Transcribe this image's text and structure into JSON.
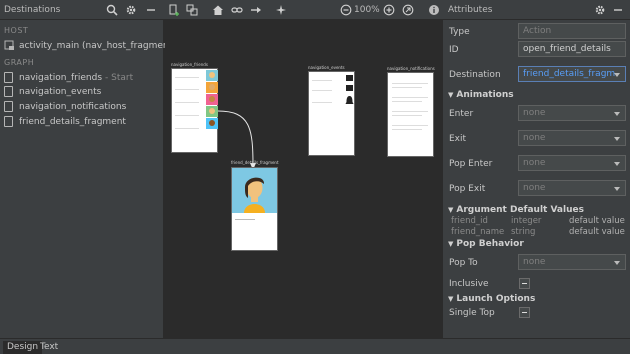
{
  "toolbar": {
    "destinations_title": "Destinations",
    "zoom": "100%",
    "attributes_title": "Attributes"
  },
  "left": {
    "host_header": "HOST",
    "host_item": "activity_main (nav_host_fragment)",
    "graph_header": "GRAPH",
    "items": [
      {
        "label": "navigation_friends",
        "sub": "- Start"
      },
      {
        "label": "navigation_events",
        "sub": ""
      },
      {
        "label": "navigation_notifications",
        "sub": ""
      },
      {
        "label": "friend_details_fragment",
        "sub": ""
      }
    ]
  },
  "canvas": {
    "screens": [
      {
        "label": "navigation_friends"
      },
      {
        "label": "navigation_events"
      },
      {
        "label": "navigation_notifications"
      },
      {
        "label": "friend_details_fragment"
      }
    ]
  },
  "attributes": {
    "type_label": "Type",
    "type_value": "Action",
    "id_label": "ID",
    "id_value": "open_friend_details",
    "destination_label": "Destination",
    "destination_value": "friend_details_fragm",
    "animations_header": "Animations",
    "enter_label": "Enter",
    "exit_label": "Exit",
    "pop_enter_label": "Pop Enter",
    "pop_exit_label": "Pop Exit",
    "none": "none",
    "arg_header": "Argument Default Values",
    "args": [
      {
        "name": "friend_id",
        "type": "integer",
        "default": "default value"
      },
      {
        "name": "friend_name",
        "type": "string",
        "default": "default value"
      }
    ],
    "pop_behavior_header": "Pop Behavior",
    "pop_to_label": "Pop To",
    "inclusive_label": "Inclusive",
    "launch_header": "Launch Options",
    "single_top_label": "Single Top"
  },
  "bottom_tabs": {
    "design": "Design",
    "text": "Text"
  },
  "colors": {
    "panel": "#3c3f41",
    "canvas": "#2b2b2b",
    "link": "#589df6"
  }
}
